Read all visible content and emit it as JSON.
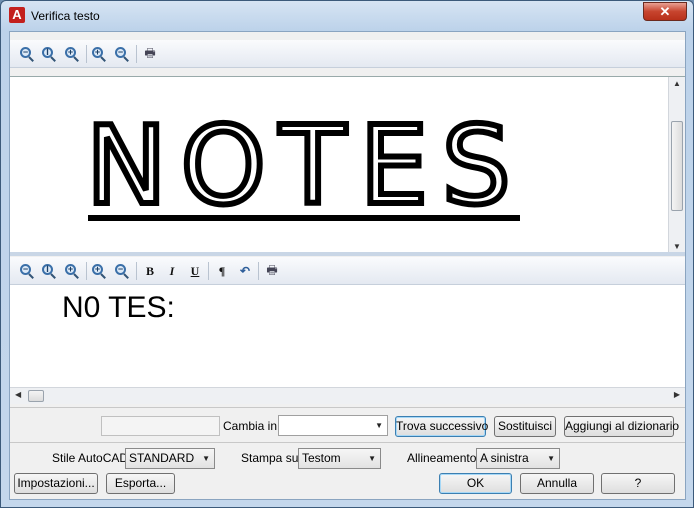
{
  "window": {
    "title": "Verifica testo",
    "close_glyph": "✕",
    "logo_glyph": "A"
  },
  "toolbar_top": {
    "icons": [
      "zoom-out-icon",
      "zoom-extents-icon",
      "zoom-window-icon",
      "zoom-in-icon",
      "zoom-out-alt-icon",
      "print-icon"
    ]
  },
  "image_preview": {
    "text": "NOTES:"
  },
  "toolbar_bottom": {
    "bold": "B",
    "italic": "I",
    "underline": "U",
    "paragraph": "¶",
    "undo": "↶"
  },
  "recognized_text": "N0 TES:",
  "replace_row": {
    "cambia_label": "Cambia in:",
    "cambia_value": "",
    "find_next": "Trova successivo",
    "replace": "Sostituisci",
    "add_dictionary": "Aggiungi al dizionario"
  },
  "options_row": {
    "style_label": "Stile AutoCAD:",
    "style_value": "STANDARD",
    "print_label": "Stampa su:",
    "print_value": "Testom",
    "align_label": "Allineamento:",
    "align_value": "A sinistra"
  },
  "footer": {
    "settings": "Impostazioni...",
    "export": "Esporta...",
    "ok": "OK",
    "cancel": "Annulla",
    "help": "?"
  }
}
